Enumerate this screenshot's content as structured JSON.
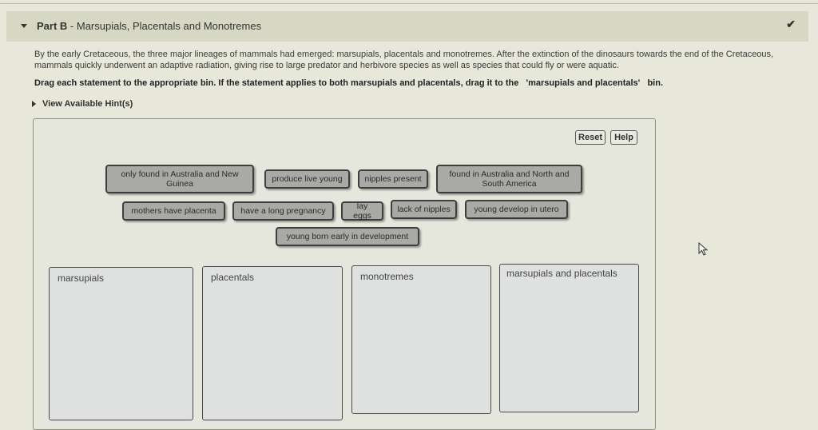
{
  "part": {
    "label": "Part B",
    "separator": " - ",
    "title": "Marsupials, Placentals and Monotremes",
    "status_icon": "checkmark-icon"
  },
  "intro_text": "By the early Cretaceous, the three major lineages of mammals had emerged: marsupials, placentals and monotremes. After the extinction of the dinosaurs towards the end of the Cretaceous, mammals quickly underwent an adaptive radiation, giving rise to large predator and herbivore species as well as species that could fly or were aquatic.",
  "instruction_text": "Drag each statement to the appropriate bin. If the statement applies to both marsupials and placentals, drag it to the   'marsupials and placentals'   bin.",
  "hint_label": "View Available Hint(s)",
  "toolbar": {
    "reset_label": "Reset",
    "help_label": "Help"
  },
  "statements": [
    "only found in Australia and New Guinea",
    "produce live young",
    "nipples present",
    "found in Australia and North and South America",
    "mothers have placenta",
    "have a long pregnancy",
    "lay eggs",
    "lack of nipples",
    "young develop in utero",
    "young born early in development"
  ],
  "bins": [
    "marsupials",
    "placentals",
    "monotremes",
    "marsupials and placentals"
  ]
}
